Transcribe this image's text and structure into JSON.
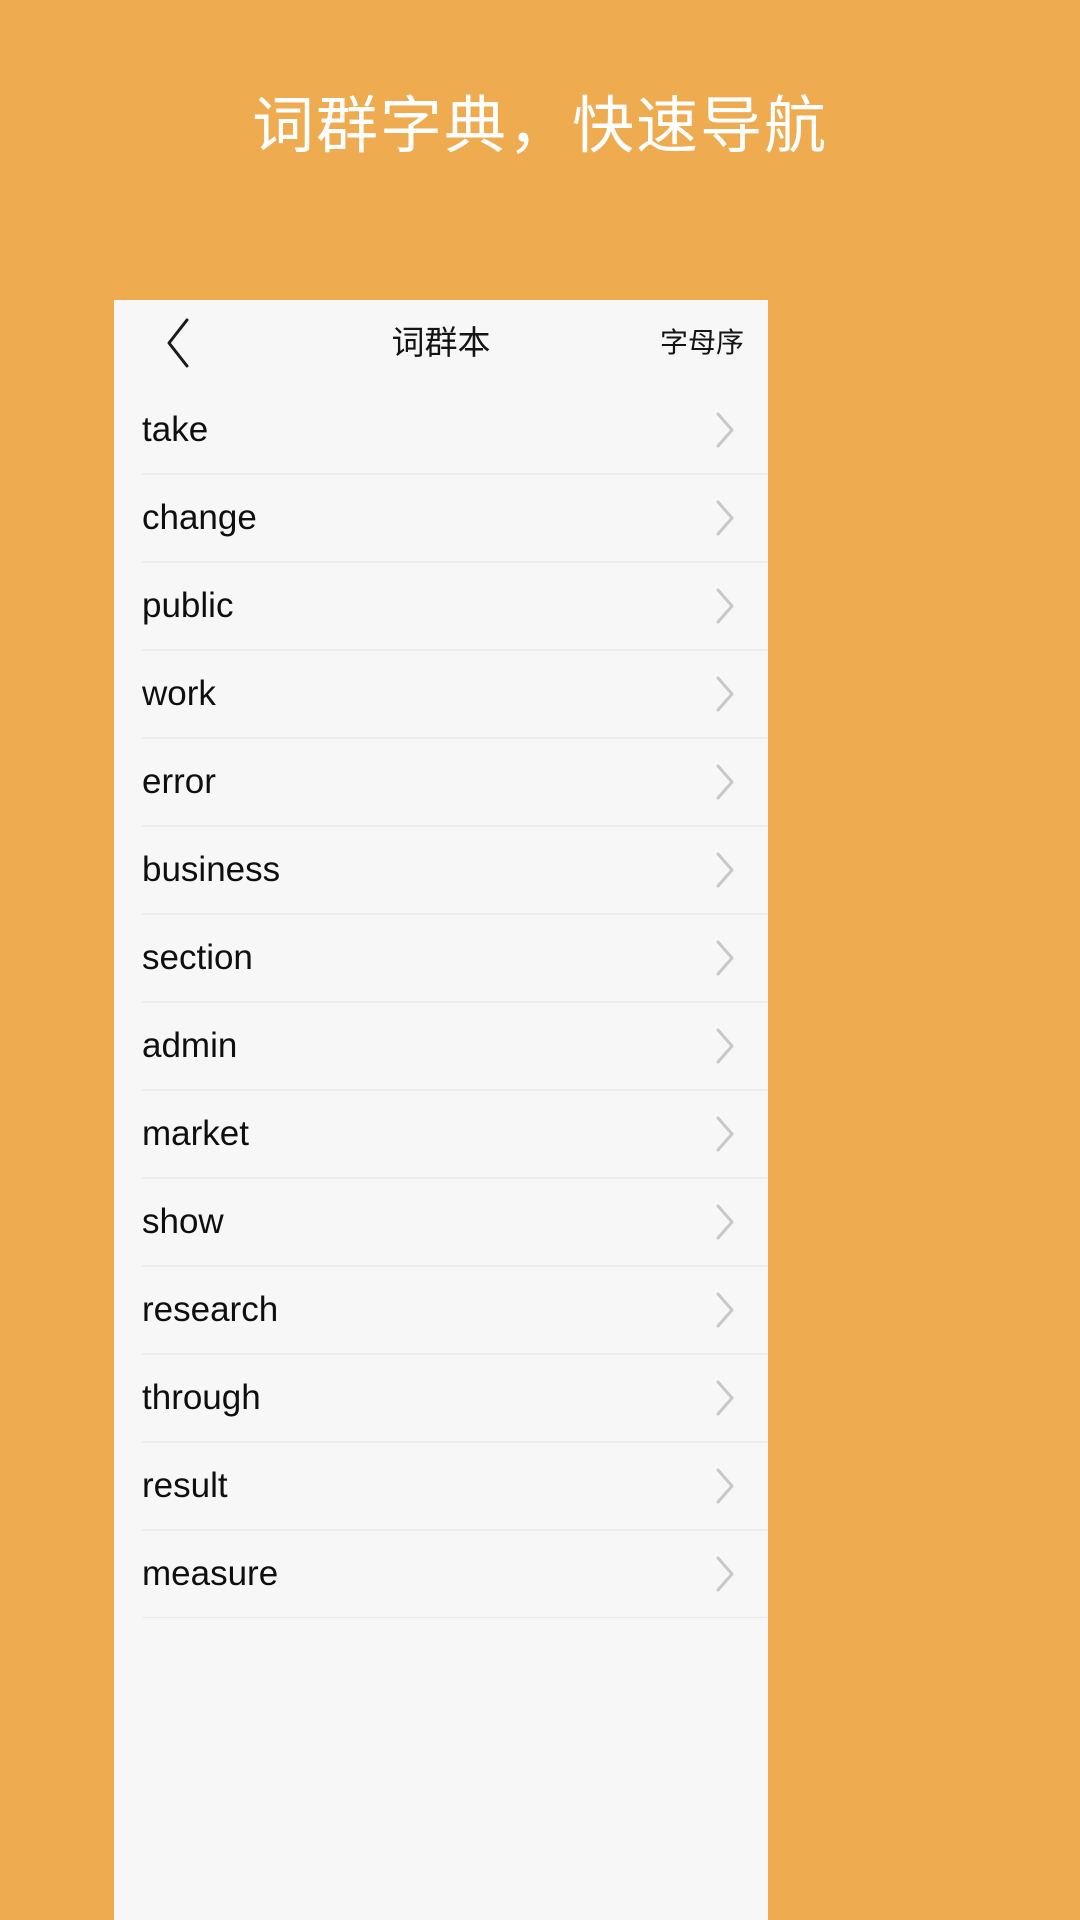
{
  "promo": {
    "headline": "词群字典，快速导航",
    "background_color": "#eeab50",
    "text_color": "#ffffff"
  },
  "card": {
    "background_color": "#f7f7f7"
  },
  "nav": {
    "back_icon": "chevron-left-icon",
    "title": "词群本",
    "action_label": "字母序"
  },
  "list": {
    "row_chevron_icon": "chevron-right-icon",
    "divider_color": "#ececec",
    "items": [
      {
        "label": "take"
      },
      {
        "label": "change"
      },
      {
        "label": "public"
      },
      {
        "label": "work"
      },
      {
        "label": "error"
      },
      {
        "label": "business"
      },
      {
        "label": "section"
      },
      {
        "label": "admin"
      },
      {
        "label": "market"
      },
      {
        "label": "show"
      },
      {
        "label": "research"
      },
      {
        "label": "through"
      },
      {
        "label": "result"
      },
      {
        "label": "measure"
      }
    ]
  }
}
